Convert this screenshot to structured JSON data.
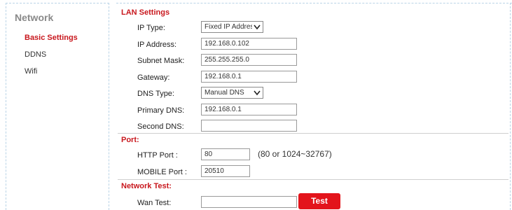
{
  "sidebar": {
    "title": "Network",
    "items": [
      {
        "label": "Basic Settings",
        "active": true
      },
      {
        "label": "DDNS",
        "active": false
      },
      {
        "label": "Wifi",
        "active": false
      }
    ]
  },
  "lan": {
    "heading": "LAN Settings",
    "ip_type": {
      "label": "IP Type:",
      "value": "Fixed IP Address"
    },
    "ip_address": {
      "label": "IP Address:",
      "value": "192.168.0.102"
    },
    "subnet": {
      "label": "Subnet Mask:",
      "value": "255.255.255.0"
    },
    "gateway": {
      "label": "Gateway:",
      "value": "192.168.0.1"
    },
    "dns_type": {
      "label": "DNS Type:",
      "value": "Manual DNS"
    },
    "primary_dns": {
      "label": "Primary DNS:",
      "value": "192.168.0.1"
    },
    "second_dns": {
      "label": "Second DNS:",
      "value": ""
    }
  },
  "port": {
    "heading": "Port:",
    "http": {
      "label": "HTTP Port :",
      "value": "80",
      "hint": "(80 or 1024~32767)"
    },
    "mobile": {
      "label": "MOBILE Port :",
      "value": "20510"
    }
  },
  "network_test": {
    "heading": "Network Test:",
    "wan": {
      "label": "Wan Test:",
      "value": ""
    },
    "button": "Test"
  },
  "colors": {
    "accent": "#c8171d",
    "button": "#e3141b"
  }
}
